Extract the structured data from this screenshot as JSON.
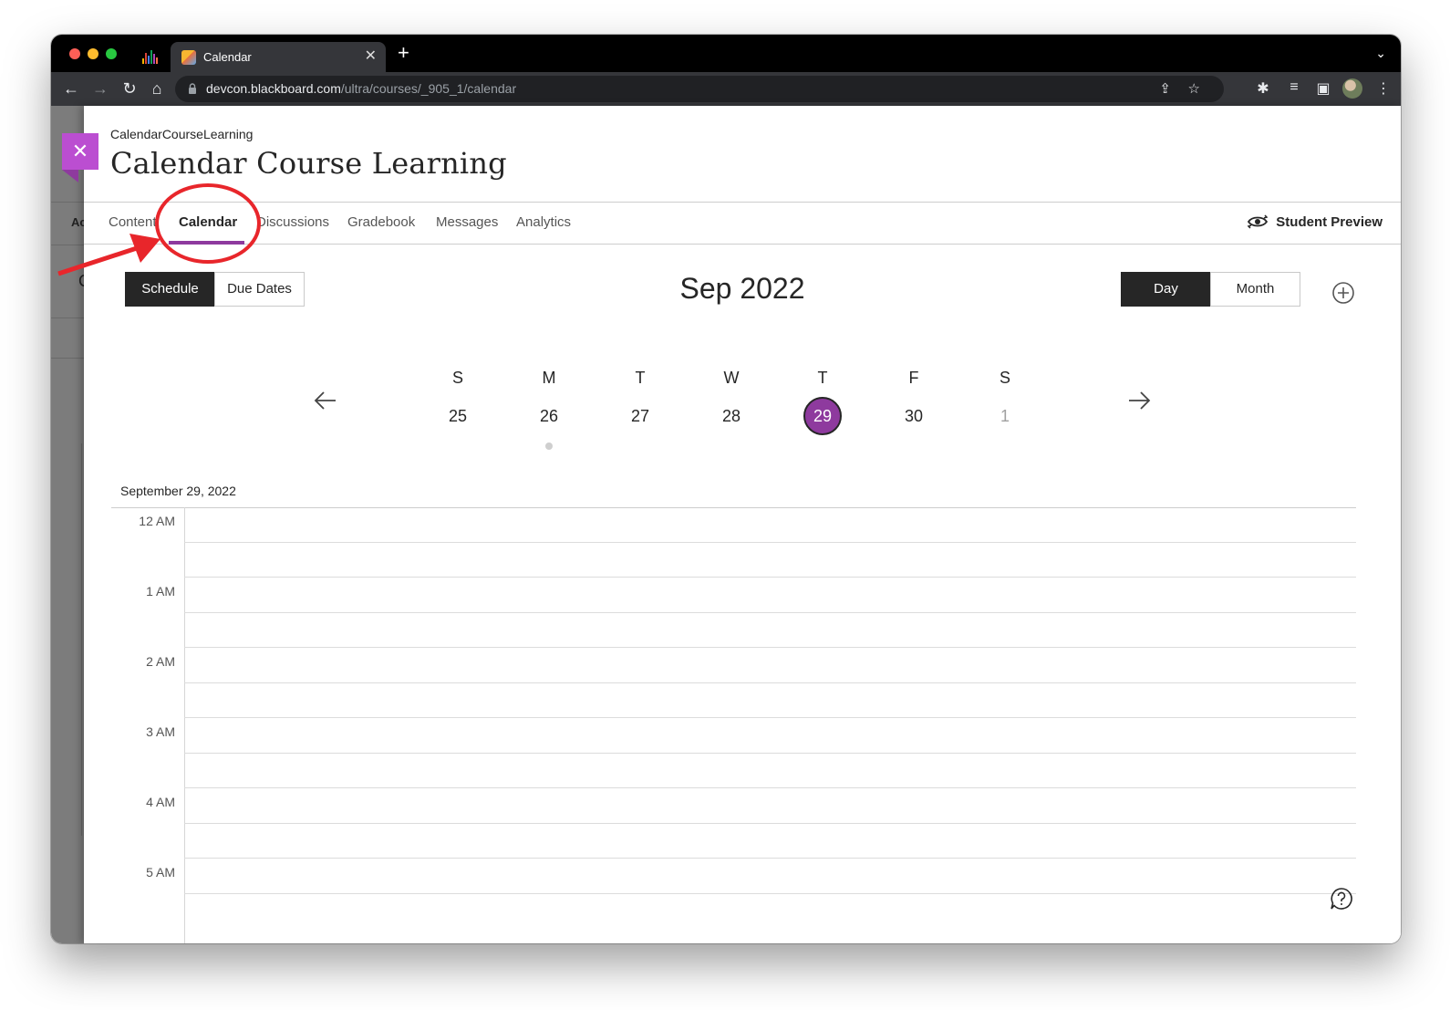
{
  "browser": {
    "tab_title": "Calendar",
    "url_host": "devcon.blackboard.com",
    "url_path": "/ultra/courses/_905_1/calendar"
  },
  "course": {
    "subtitle": "CalendarCourseLearning",
    "title": "Calendar Course Learning",
    "nav": [
      {
        "label": "Content"
      },
      {
        "label": "Calendar",
        "active": true
      },
      {
        "label": "Discussions"
      },
      {
        "label": "Gradebook"
      },
      {
        "label": "Messages"
      },
      {
        "label": "Analytics"
      }
    ],
    "student_preview": "Student Preview"
  },
  "sidebar": {
    "text_top": "Ac",
    "text_mid": "C"
  },
  "calendar": {
    "view_toggle": {
      "schedule": "Schedule",
      "due_dates": "Due Dates"
    },
    "period_toggle": {
      "day": "Day",
      "month": "Month"
    },
    "month_title": "Sep 2022",
    "week": [
      {
        "letter": "S",
        "day": "25"
      },
      {
        "letter": "M",
        "day": "26",
        "has_event": true
      },
      {
        "letter": "T",
        "day": "27"
      },
      {
        "letter": "W",
        "day": "28"
      },
      {
        "letter": "T",
        "day": "29",
        "selected": true
      },
      {
        "letter": "F",
        "day": "30"
      },
      {
        "letter": "S",
        "day": "1",
        "other_month": true
      }
    ],
    "date_heading": "September 29, 2022",
    "hours": [
      "12 AM",
      "1 AM",
      "2 AM",
      "3 AM",
      "4 AM",
      "5 AM"
    ]
  },
  "colors": {
    "accent": "#8e3a9e",
    "close_button": "#bb4ed1",
    "annotation": "#e8262b"
  }
}
